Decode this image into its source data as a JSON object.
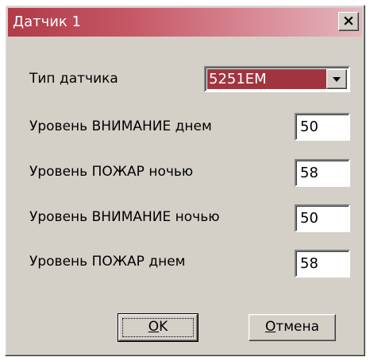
{
  "window": {
    "title": "Датчик 1",
    "close_glyph": "×",
    "titlebar_color": "#b03a48"
  },
  "sensor_type": {
    "label": "Тип датчика",
    "value": "5251ЕМ",
    "selection_color": "#a0353f"
  },
  "levels": [
    {
      "label": "Уровень ВНИМАНИЕ днем",
      "value": "50"
    },
    {
      "label": "Уровень ПОЖАР ночью",
      "value": "58"
    },
    {
      "label": "Уровень ВНИМАНИЕ ночью",
      "value": "50"
    },
    {
      "label": "Уровень ПОЖАР днем",
      "value": "58"
    }
  ],
  "buttons": {
    "ok": {
      "mnemonic": "O",
      "rest": "K"
    },
    "cancel": {
      "mnemonic": "О",
      "rest": "тмена"
    }
  }
}
